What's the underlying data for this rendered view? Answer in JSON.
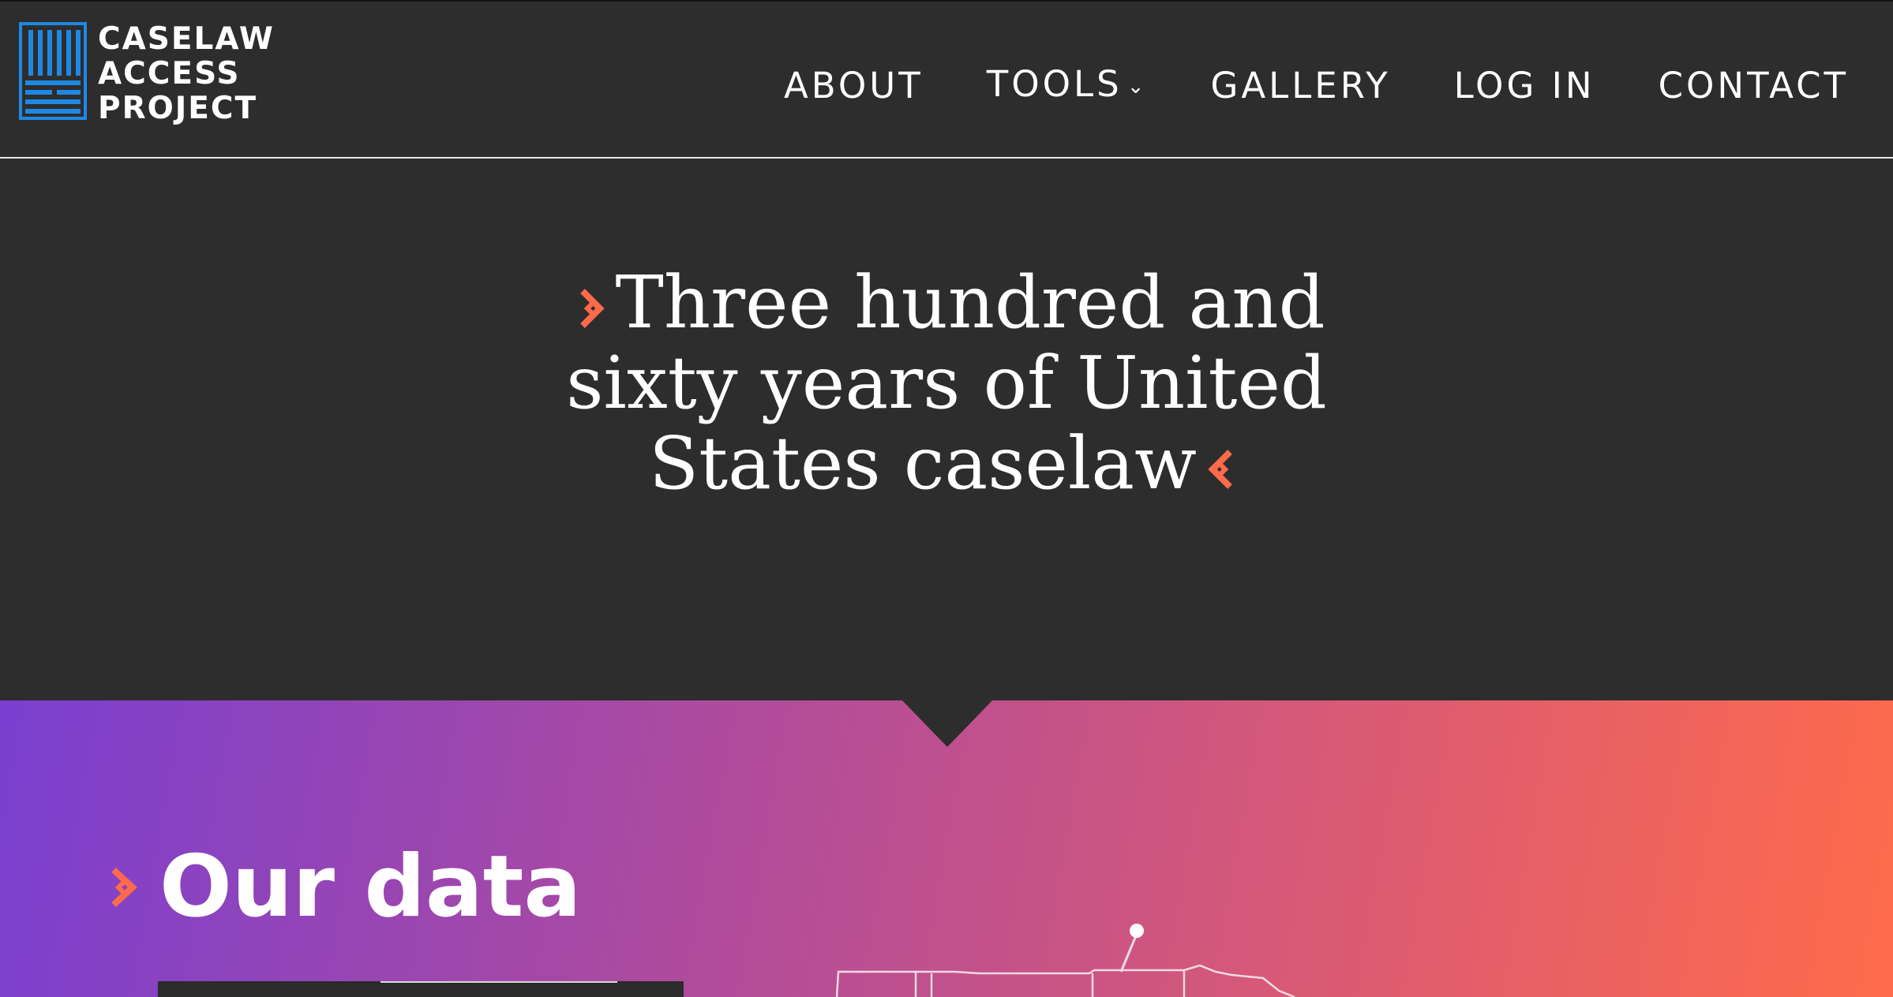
{
  "brand": {
    "name_lines": [
      "CASELAW",
      "ACCESS",
      "PROJECT"
    ],
    "logo_color": "#1e88e5"
  },
  "nav": {
    "items": [
      {
        "label": "ABOUT",
        "has_dropdown": false
      },
      {
        "label": "TOOLS",
        "has_dropdown": true,
        "dropdown_icon": "chevron-down-icon"
      },
      {
        "label": "GALLERY",
        "has_dropdown": false
      },
      {
        "label": "LOG IN",
        "has_dropdown": false
      },
      {
        "label": "CONTACT",
        "has_dropdown": false
      }
    ]
  },
  "hero": {
    "title_lines": [
      "Three hundred and",
      "sixty years of United",
      "States caselaw"
    ],
    "accent_color": "#ff6b4a"
  },
  "section": {
    "heading": "Our data",
    "gradient": [
      "#7a3fd0",
      "#ff6b4a"
    ]
  },
  "colors": {
    "background": "#2d2d2d",
    "text": "#ffffff",
    "mountain_left": "#5a4fe0",
    "mountain_right": "#ff6b5a"
  }
}
